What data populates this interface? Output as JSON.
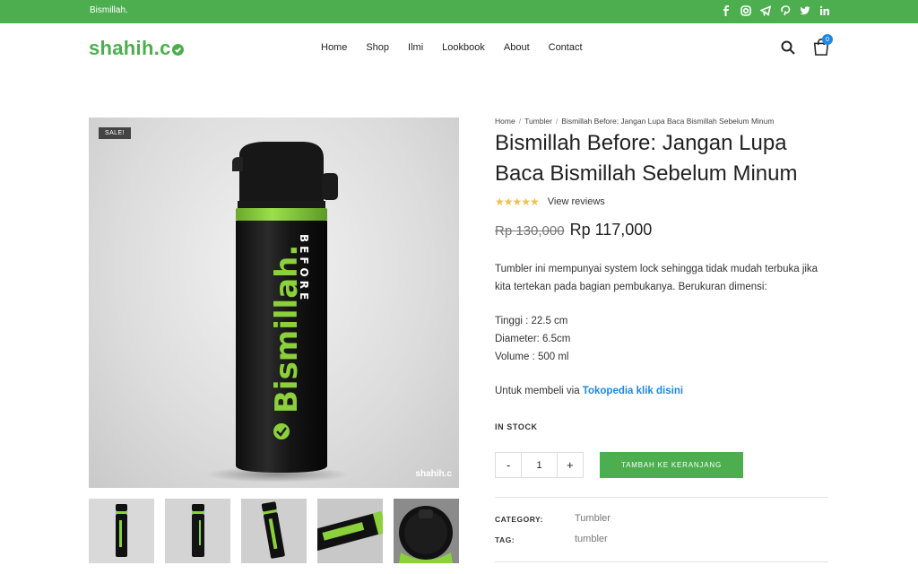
{
  "topbar": {
    "tagline": "Bismillah.",
    "social": [
      "facebook-icon",
      "instagram-icon",
      "telegram-icon",
      "pinterest-icon",
      "twitter-icon",
      "linkedin-icon"
    ],
    "background": "#4cae4f"
  },
  "header": {
    "logo": "shahih.c",
    "nav": [
      "Home",
      "Shop",
      "Ilmi",
      "Lookbook",
      "About",
      "Contact"
    ],
    "cart_count": "0"
  },
  "product": {
    "sale_badge": "SALE!",
    "image_bottle_text": "Bismillah.",
    "image_bottle_sub": "BEFORE",
    "watermark": "shahih.c",
    "thumbnails": 5,
    "breadcrumb": [
      "Home",
      "Tumbler",
      "Bismillah Before: Jangan Lupa Baca Bismillah Sebelum Minum"
    ],
    "title": "Bismillah Before: Jangan Lupa Baca Bismillah Sebelum Minum",
    "rating": 5,
    "reviews_link": "View reviews",
    "price_old": "Rp 130,000",
    "price_new": "Rp 117,000",
    "description": "Tumbler ini mempunyai system lock sehingga tidak mudah terbuka jika kita tertekan pada bagian pembukanya. Berukuran dimensi:",
    "specs": [
      "Tinggi : 22.5 cm",
      "Diameter: 6.5cm",
      "Volume : 500 ml"
    ],
    "buy_prefix": "Untuk membeli via",
    "buy_link": "Tokopedia klik disini",
    "stock": "IN STOCK",
    "qty_minus": "-",
    "qty_value": "1",
    "qty_plus": "+",
    "add_to_cart": "TAMBAH KE KERANJANG",
    "category_label": "CATEGORY:",
    "category_value": "Tumbler",
    "tag_label": "TAG:",
    "tag_value": "tumbler"
  },
  "colors": {
    "accent": "#4cae4f",
    "link": "#1e88e5",
    "bottle_green": "#8bd13b"
  }
}
